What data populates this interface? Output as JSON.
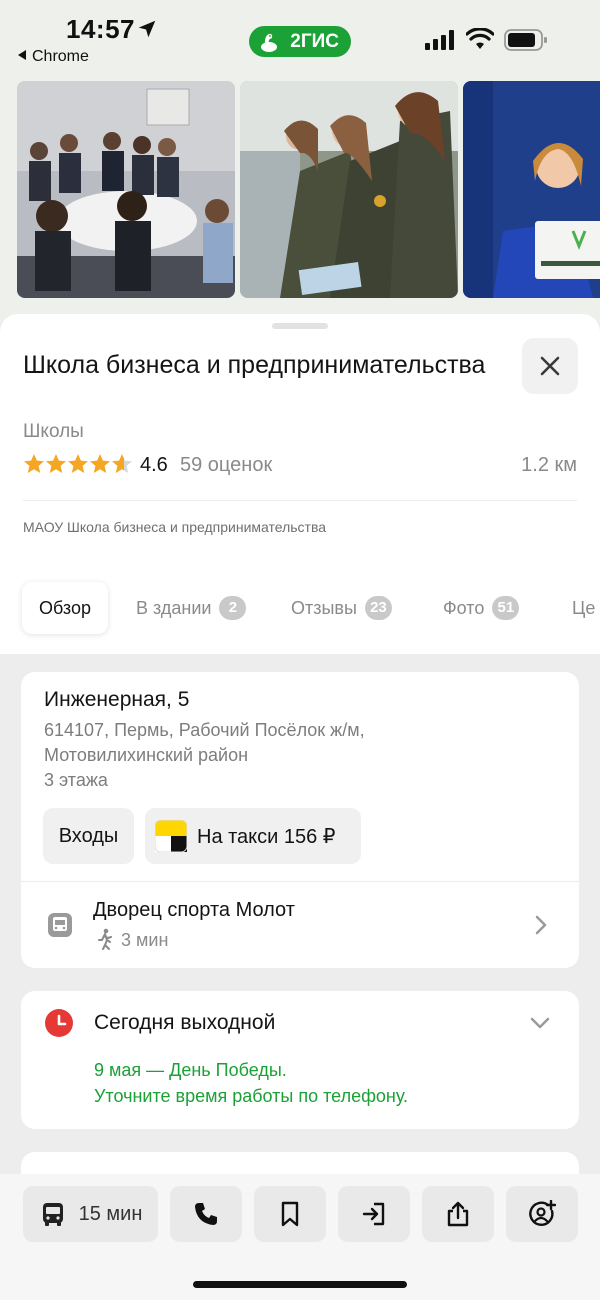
{
  "status_bar": {
    "time": "14:57",
    "back_app": "Chrome",
    "brand": "2ГИС",
    "brand_color": "#1ba136"
  },
  "photos": [
    "photo-meeting",
    "photo-cadets",
    "photo-sign-holder"
  ],
  "place": {
    "title": "Школа бизнеса и предпринимательства",
    "category": "Школы",
    "rating": "4.6",
    "rating_stars": 4.6,
    "reviews": "59 оценок",
    "distance": "1.2 км",
    "legal_name": "МАОУ Школа бизнеса и предпринимательства"
  },
  "tabs": [
    {
      "label": "Обзор",
      "badge": ""
    },
    {
      "label": "В здании",
      "badge": "2"
    },
    {
      "label": "Отзывы",
      "badge": "23"
    },
    {
      "label": "Фото",
      "badge": "51"
    },
    {
      "label": "Це",
      "badge": ""
    }
  ],
  "address": {
    "street": "Инженерная, 5",
    "line1": "614107, Пермь, Рабочий Посёлок ж/м,",
    "line2": "Мотовилихинский район",
    "floors": "3 этажа",
    "entrances_button": "Входы",
    "taxi_button": "На такси 156 ₽"
  },
  "transit": {
    "stop": "Дворец спорта Молот",
    "walk": "3 мин"
  },
  "hours": {
    "status": "Сегодня выходной",
    "holiday_line1": "9 мая — День Победы.",
    "holiday_line2": "Уточните время работы по телефону.",
    "accent_red": "#e53935",
    "accent_green": "#1ba136"
  },
  "bottom_bar": {
    "route_label": "15 мин",
    "actions": [
      "bus-icon",
      "phone-icon",
      "bookmark-icon",
      "entrance-icon",
      "share-icon",
      "add-friend-icon"
    ]
  }
}
